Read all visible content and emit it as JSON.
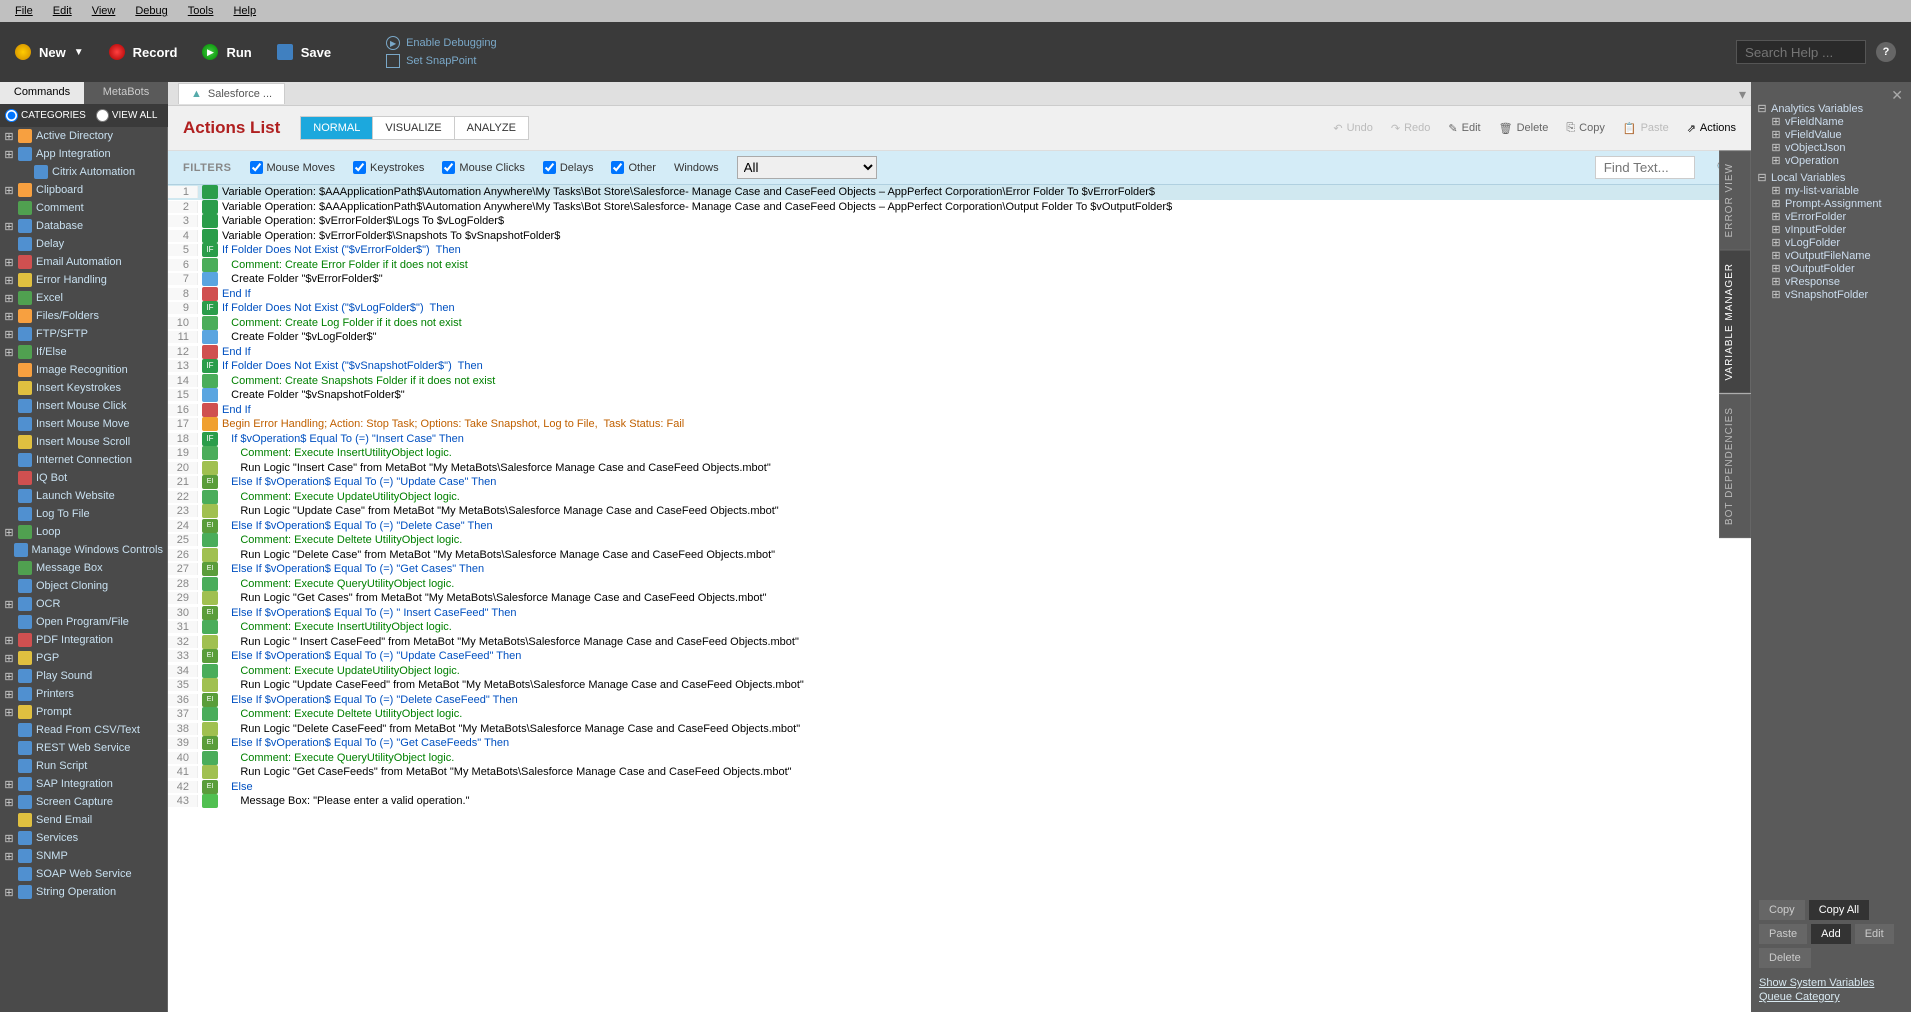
{
  "menubar": [
    "File",
    "Edit",
    "View",
    "Debug",
    "Tools",
    "Help"
  ],
  "toolbar": {
    "new": "New",
    "record": "Record",
    "run": "Run",
    "save": "Save",
    "enable_debug": "Enable Debugging",
    "set_snap": "Set SnapPoint",
    "search_placeholder": "Search Help ..."
  },
  "sidebar": {
    "tabs": [
      "Commands",
      "MetaBots"
    ],
    "categories": "CATEGORIES",
    "viewall": "VIEW ALL",
    "items": [
      {
        "l": "Active Directory",
        "e": "+",
        "c": ""
      },
      {
        "l": "App Integration",
        "e": "+",
        "c": "b"
      },
      {
        "l": "Citrix Automation",
        "e": "",
        "c": "b",
        "indent": 1
      },
      {
        "l": "Clipboard",
        "e": "+",
        "c": ""
      },
      {
        "l": "Comment",
        "e": "",
        "c": "g"
      },
      {
        "l": "Database",
        "e": "+",
        "c": "b"
      },
      {
        "l": "Delay",
        "e": "",
        "c": "b"
      },
      {
        "l": "Email Automation",
        "e": "+",
        "c": "r"
      },
      {
        "l": "Error Handling",
        "e": "+",
        "c": "y"
      },
      {
        "l": "Excel",
        "e": "+",
        "c": "g"
      },
      {
        "l": "Files/Folders",
        "e": "+",
        "c": ""
      },
      {
        "l": "FTP/SFTP",
        "e": "+",
        "c": "b"
      },
      {
        "l": "If/Else",
        "e": "+",
        "c": "g"
      },
      {
        "l": "Image Recognition",
        "e": "",
        "c": ""
      },
      {
        "l": "Insert Keystrokes",
        "e": "",
        "c": "y"
      },
      {
        "l": "Insert Mouse Click",
        "e": "",
        "c": "b"
      },
      {
        "l": "Insert Mouse Move",
        "e": "",
        "c": "b"
      },
      {
        "l": "Insert Mouse Scroll",
        "e": "",
        "c": "y"
      },
      {
        "l": "Internet Connection",
        "e": "",
        "c": "b"
      },
      {
        "l": "IQ Bot",
        "e": "",
        "c": "r"
      },
      {
        "l": "Launch Website",
        "e": "",
        "c": "b"
      },
      {
        "l": "Log To File",
        "e": "",
        "c": "b"
      },
      {
        "l": "Loop",
        "e": "+",
        "c": "g"
      },
      {
        "l": "Manage Windows Controls",
        "e": "",
        "c": "b"
      },
      {
        "l": "Message Box",
        "e": "",
        "c": "g"
      },
      {
        "l": "Object Cloning",
        "e": "",
        "c": "b"
      },
      {
        "l": "OCR",
        "e": "+",
        "c": "b"
      },
      {
        "l": "Open Program/File",
        "e": "",
        "c": "b"
      },
      {
        "l": "PDF Integration",
        "e": "+",
        "c": "r"
      },
      {
        "l": "PGP",
        "e": "+",
        "c": "y"
      },
      {
        "l": "Play Sound",
        "e": "+",
        "c": "b"
      },
      {
        "l": "Printers",
        "e": "+",
        "c": "b"
      },
      {
        "l": "Prompt",
        "e": "+",
        "c": "y"
      },
      {
        "l": "Read From CSV/Text",
        "e": "",
        "c": "b"
      },
      {
        "l": "REST Web Service",
        "e": "",
        "c": "b"
      },
      {
        "l": "Run Script",
        "e": "",
        "c": "b"
      },
      {
        "l": "SAP Integration",
        "e": "+",
        "c": "b"
      },
      {
        "l": "Screen Capture",
        "e": "+",
        "c": "b"
      },
      {
        "l": "Send Email",
        "e": "",
        "c": "y"
      },
      {
        "l": "Services",
        "e": "+",
        "c": "b"
      },
      {
        "l": "SNMP",
        "e": "+",
        "c": "b"
      },
      {
        "l": "SOAP Web Service",
        "e": "",
        "c": "b"
      },
      {
        "l": "String Operation",
        "e": "+",
        "c": "b"
      }
    ]
  },
  "doc": {
    "tab": "Salesforce ...",
    "title": "Actions List",
    "views": [
      "NORMAL",
      "VISUALIZE",
      "ANALYZE"
    ],
    "actions": [
      "Undo",
      "Redo",
      "Edit",
      "Delete",
      "Copy",
      "Paste",
      "Actions"
    ]
  },
  "filters": {
    "label": "FILTERS",
    "items": [
      "Mouse Moves",
      "Keystrokes",
      "Mouse Clicks",
      "Delays",
      "Other"
    ],
    "windows": "Windows",
    "windows_sel": "All",
    "find": "Find Text..."
  },
  "code": [
    {
      "n": 1,
      "i": "var",
      "c": "black",
      "t": "Variable Operation: $AAApplicationPath$\\Automation Anywhere\\My Tasks\\Bot Store\\Salesforce- Manage Case and CaseFeed Objects – AppPerfect Corporation\\Error Folder To $vErrorFolder$",
      "sel": true
    },
    {
      "n": 2,
      "i": "var",
      "c": "black",
      "t": "Variable Operation: $AAApplicationPath$\\Automation Anywhere\\My Tasks\\Bot Store\\Salesforce- Manage Case and CaseFeed Objects – AppPerfect Corporation\\Output Folder To $vOutputFolder$"
    },
    {
      "n": 3,
      "i": "var",
      "c": "black",
      "t": "Variable Operation: $vErrorFolder$\\Logs To $vLogFolder$"
    },
    {
      "n": 4,
      "i": "var",
      "c": "black",
      "t": "Variable Operation: $vErrorFolder$\\Snapshots To $vSnapshotFolder$"
    },
    {
      "n": 5,
      "i": "if",
      "c": "blue",
      "t": "If Folder Does Not Exist (\"$vErrorFolder$\")  Then"
    },
    {
      "n": 6,
      "i": "cmt",
      "c": "green",
      "t": "   Comment: Create Error Folder if it does not exist"
    },
    {
      "n": 7,
      "i": "fld",
      "c": "black",
      "t": "   Create Folder \"$vErrorFolder$\""
    },
    {
      "n": 8,
      "i": "end",
      "c": "blue",
      "t": "End If"
    },
    {
      "n": 9,
      "i": "if",
      "c": "blue",
      "t": "If Folder Does Not Exist (\"$vLogFolder$\")  Then"
    },
    {
      "n": 10,
      "i": "cmt",
      "c": "green",
      "t": "   Comment: Create Log Folder if it does not exist"
    },
    {
      "n": 11,
      "i": "fld",
      "c": "black",
      "t": "   Create Folder \"$vLogFolder$\""
    },
    {
      "n": 12,
      "i": "end",
      "c": "blue",
      "t": "End If"
    },
    {
      "n": 13,
      "i": "if",
      "c": "blue",
      "t": "If Folder Does Not Exist (\"$vSnapshotFolder$\")  Then"
    },
    {
      "n": 14,
      "i": "cmt",
      "c": "green",
      "t": "   Comment: Create Snapshots Folder if it does not exist"
    },
    {
      "n": 15,
      "i": "fld",
      "c": "black",
      "t": "   Create Folder \"$vSnapshotFolder$\""
    },
    {
      "n": 16,
      "i": "end",
      "c": "blue",
      "t": "End If"
    },
    {
      "n": 17,
      "i": "warn",
      "c": "orange",
      "t": "Begin Error Handling; Action: Stop Task; Options: Take Snapshot, Log to File,  Task Status: Fail"
    },
    {
      "n": 18,
      "i": "if",
      "c": "blue",
      "t": "   If $vOperation$ Equal To (=) \"Insert Case\" Then"
    },
    {
      "n": 19,
      "i": "cmt",
      "c": "green",
      "t": "      Comment: Execute InsertUtilityObject logic."
    },
    {
      "n": 20,
      "i": "run",
      "c": "black",
      "t": "      Run Logic \"Insert Case\" from MetaBot \"My MetaBots\\Salesforce Manage Case and CaseFeed Objects.mbot\""
    },
    {
      "n": 21,
      "i": "else",
      "c": "blue",
      "t": "   Else If $vOperation$ Equal To (=) \"Update Case\" Then"
    },
    {
      "n": 22,
      "i": "cmt",
      "c": "green",
      "t": "      Comment: Execute UpdateUtilityObject logic."
    },
    {
      "n": 23,
      "i": "run",
      "c": "black",
      "t": "      Run Logic \"Update Case\" from MetaBot \"My MetaBots\\Salesforce Manage Case and CaseFeed Objects.mbot\""
    },
    {
      "n": 24,
      "i": "else",
      "c": "blue",
      "t": "   Else If $vOperation$ Equal To (=) \"Delete Case\" Then"
    },
    {
      "n": 25,
      "i": "cmt",
      "c": "green",
      "t": "      Comment: Execute Deltete UtilityObject logic."
    },
    {
      "n": 26,
      "i": "run",
      "c": "black",
      "t": "      Run Logic \"Delete Case\" from MetaBot \"My MetaBots\\Salesforce Manage Case and CaseFeed Objects.mbot\""
    },
    {
      "n": 27,
      "i": "else",
      "c": "blue",
      "t": "   Else If $vOperation$ Equal To (=) \"Get Cases\" Then"
    },
    {
      "n": 28,
      "i": "cmt",
      "c": "green",
      "t": "      Comment: Execute QueryUtilityObject logic."
    },
    {
      "n": 29,
      "i": "run",
      "c": "black",
      "t": "      Run Logic \"Get Cases\" from MetaBot \"My MetaBots\\Salesforce Manage Case and CaseFeed Objects.mbot\""
    },
    {
      "n": 30,
      "i": "else",
      "c": "blue",
      "t": "   Else If $vOperation$ Equal To (=) \" Insert CaseFeed\" Then"
    },
    {
      "n": 31,
      "i": "cmt",
      "c": "green",
      "t": "      Comment: Execute InsertUtilityObject logic."
    },
    {
      "n": 32,
      "i": "run",
      "c": "black",
      "t": "      Run Logic \" Insert CaseFeed\" from MetaBot \"My MetaBots\\Salesforce Manage Case and CaseFeed Objects.mbot\""
    },
    {
      "n": 33,
      "i": "else",
      "c": "blue",
      "t": "   Else If $vOperation$ Equal To (=) \"Update CaseFeed\" Then"
    },
    {
      "n": 34,
      "i": "cmt",
      "c": "green",
      "t": "      Comment: Execute UpdateUtilityObject logic."
    },
    {
      "n": 35,
      "i": "run",
      "c": "black",
      "t": "      Run Logic \"Update CaseFeed\" from MetaBot \"My MetaBots\\Salesforce Manage Case and CaseFeed Objects.mbot\""
    },
    {
      "n": 36,
      "i": "else",
      "c": "blue",
      "t": "   Else If $vOperation$ Equal To (=) \"Delete CaseFeed\" Then"
    },
    {
      "n": 37,
      "i": "cmt",
      "c": "green",
      "t": "      Comment: Execute Deltete UtilityObject logic."
    },
    {
      "n": 38,
      "i": "run",
      "c": "black",
      "t": "      Run Logic \"Delete CaseFeed\" from MetaBot \"My MetaBots\\Salesforce Manage Case and CaseFeed Objects.mbot\""
    },
    {
      "n": 39,
      "i": "else",
      "c": "blue",
      "t": "   Else If $vOperation$ Equal To (=) \"Get CaseFeeds\" Then"
    },
    {
      "n": 40,
      "i": "cmt",
      "c": "green",
      "t": "      Comment: Execute QueryUtilityObject logic."
    },
    {
      "n": 41,
      "i": "run",
      "c": "black",
      "t": "      Run Logic \"Get CaseFeeds\" from MetaBot \"My MetaBots\\Salesforce Manage Case and CaseFeed Objects.mbot\""
    },
    {
      "n": 42,
      "i": "else",
      "c": "blue",
      "t": "   Else"
    },
    {
      "n": 43,
      "i": "msg",
      "c": "black",
      "t": "      Message Box: \"Please enter a valid operation.\""
    }
  ],
  "vars": {
    "analytics": {
      "label": "Analytics Variables",
      "items": [
        "vFieldName",
        "vFieldValue",
        "vObjectJson",
        "vOperation"
      ]
    },
    "local": {
      "label": "Local Variables",
      "items": [
        "my-list-variable",
        "Prompt-Assignment",
        "vErrorFolder",
        "vInputFolder",
        "vLogFolder",
        "vOutputFileName",
        "vOutputFolder",
        "vResponse",
        "vSnapshotFolder"
      ]
    },
    "buttons": [
      "Copy",
      "Copy All",
      "Paste",
      "Add",
      "Edit",
      "Delete"
    ],
    "links": [
      "Show System Variables",
      "Queue Category"
    ]
  },
  "vtabs": [
    "ERROR VIEW",
    "VARIABLE MANAGER",
    "BOT DEPENDENCIES"
  ]
}
